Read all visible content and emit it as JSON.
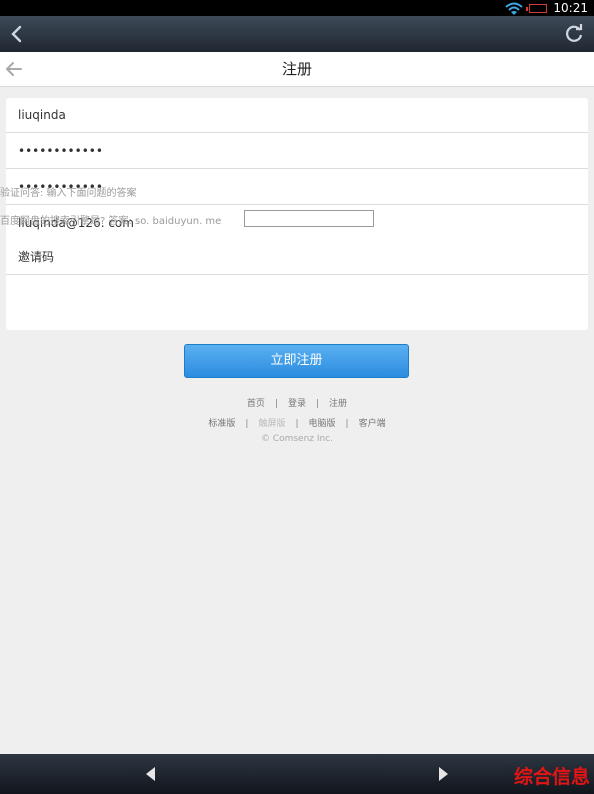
{
  "status_bar": {
    "time": "10:21",
    "icons": [
      "wifi-icon",
      "battery-icon"
    ],
    "battery_color": "#d43b3b"
  },
  "browser_bar": {
    "back_icon": "chevron-left-icon",
    "refresh_icon": "refresh-icon"
  },
  "header": {
    "back_icon": "arrow-left-icon",
    "title": "注册"
  },
  "form": {
    "username": "liuqinda",
    "password": "••••••••••••",
    "password_confirm": "••••••••••••",
    "email": "liuqinda@126. com",
    "invite_code_placeholder": "邀请码",
    "hint": "验证问答: 输入下面问题的答案",
    "question": "百度网盘的搜索引擎是? 答案: so. baiduyun. me",
    "answer": ""
  },
  "submit": {
    "label": "立即注册",
    "color": "#2b8ce0"
  },
  "footer": {
    "row1": [
      "首页",
      "登录",
      "注册"
    ],
    "row2": [
      "标准版",
      "触屏版",
      "电脑版",
      "客户端"
    ],
    "copyright": "© Comsenz Inc."
  },
  "bottom_bar": {
    "prev_icon": "triangle-left-icon",
    "next_icon": "triangle-right-icon",
    "watermark": "综合信息",
    "watermark_color": "#e21515"
  }
}
